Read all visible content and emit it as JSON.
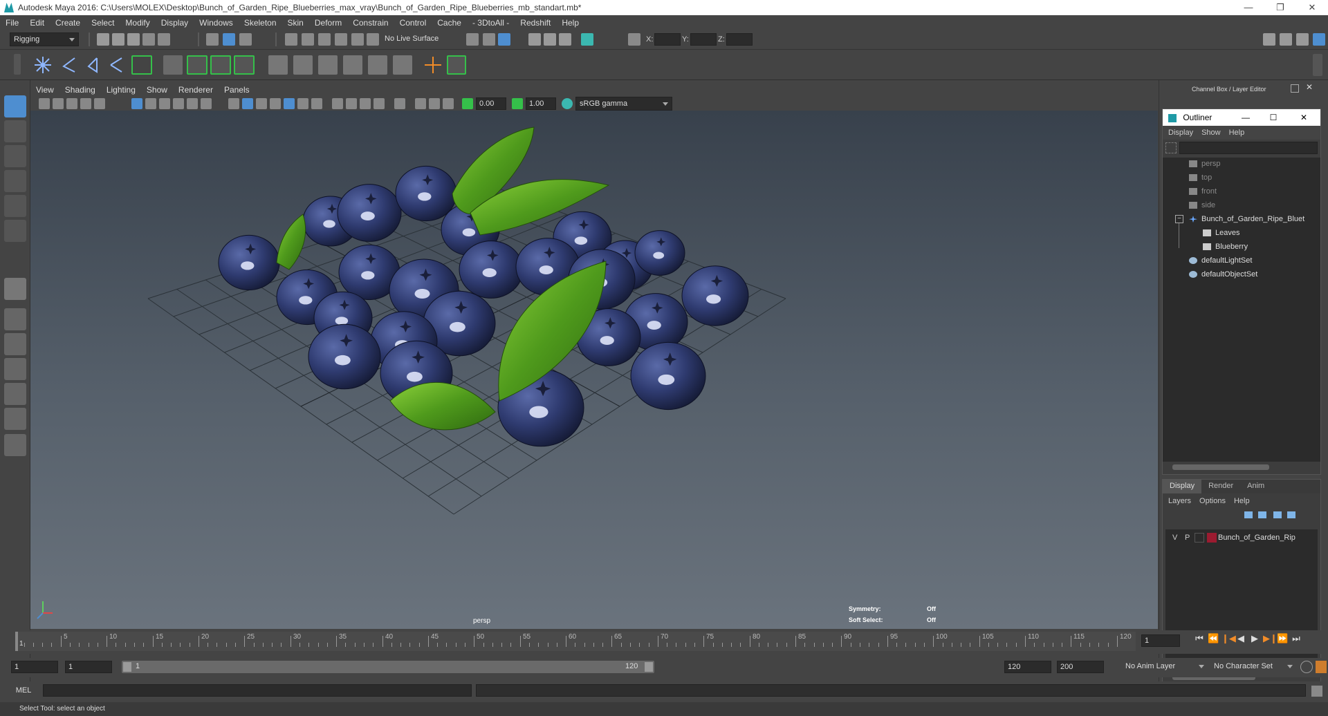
{
  "window": {
    "title": "Autodesk Maya 2016: C:\\Users\\MOLEX\\Desktop\\Bunch_of_Garden_Ripe_Blueberries_max_vray\\Bunch_of_Garden_Ripe_Blueberries_mb_standart.mb*",
    "minimize": "—",
    "maximize": "❐",
    "close": "✕"
  },
  "menu": [
    "File",
    "Edit",
    "Create",
    "Select",
    "Modify",
    "Display",
    "Windows",
    "Skeleton",
    "Skin",
    "Deform",
    "Constrain",
    "Control",
    "Cache",
    "- 3DtoAll -",
    "Redshift",
    "Help"
  ],
  "shelf": {
    "mode": "Rigging",
    "live_surface": "No Live Surface",
    "x_label": "X:",
    "y_label": "Y:",
    "z_label": "Z:"
  },
  "viewport": {
    "menu": [
      "View",
      "Shading",
      "Lighting",
      "Show",
      "Renderer",
      "Panels"
    ],
    "exposure": "0.00",
    "gamma": "1.00",
    "color_space": "sRGB gamma",
    "camera_label": "persp",
    "symmetry_label": "Symmetry:",
    "symmetry_value": "Off",
    "soft_select_label": "Soft Select:",
    "soft_select_value": "Off"
  },
  "channel_box": {
    "title": "Channel Box / Layer Editor"
  },
  "outliner": {
    "title": "Outliner",
    "menu": [
      "Display",
      "Show",
      "Help"
    ],
    "items": [
      {
        "label": "persp",
        "type": "camera"
      },
      {
        "label": "top",
        "type": "camera"
      },
      {
        "label": "front",
        "type": "camera"
      },
      {
        "label": "side",
        "type": "camera"
      },
      {
        "label": "Bunch_of_Garden_Ripe_Bluet",
        "type": "group"
      },
      {
        "label": "Leaves",
        "type": "mesh"
      },
      {
        "label": "Blueberry",
        "type": "mesh"
      },
      {
        "label": "defaultLightSet",
        "type": "set"
      },
      {
        "label": "defaultObjectSet",
        "type": "set"
      }
    ]
  },
  "layer_editor": {
    "tabs": [
      "Display",
      "Render",
      "Anim"
    ],
    "menu": [
      "Layers",
      "Options",
      "Help"
    ],
    "layer": {
      "v": "V",
      "p": "P",
      "name": "Bunch_of_Garden_Rip",
      "color": "#9b1b30"
    }
  },
  "timeline": {
    "ticks": [
      "5",
      "10",
      "15",
      "20",
      "25",
      "30",
      "35",
      "40",
      "45",
      "50",
      "55",
      "60",
      "65",
      "70",
      "75",
      "80",
      "85",
      "90",
      "95",
      "100",
      "105",
      "110",
      "115",
      "120"
    ],
    "first": "1",
    "current_frame": "1"
  },
  "range": {
    "start": "1",
    "playback_start": "1",
    "slider_start": "1",
    "slider_end": "120",
    "playback_end": "120",
    "end": "200",
    "anim_layer": "No Anim Layer",
    "character_set": "No Character Set"
  },
  "command": {
    "label": "MEL"
  },
  "help_line": "Select Tool: select an object",
  "colors": {
    "accent": "#1f9aa6",
    "shelf_green": "#35c04a",
    "berry": "#2d3a66",
    "leaf": "#5ea325"
  }
}
